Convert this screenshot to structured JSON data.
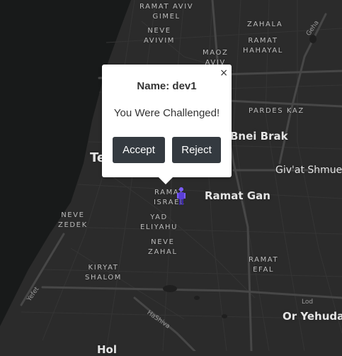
{
  "map": {
    "places": [
      {
        "key": "ramat_aviv_gimel",
        "label": "RAMAT AVIV\nGIMEL"
      },
      {
        "key": "neve_avivim",
        "label": "NEVE\nAVIVIM"
      },
      {
        "key": "zahala",
        "label": "ZAHALA"
      },
      {
        "key": "maoz_aviv",
        "label": "MAOZ\nAVIV"
      },
      {
        "key": "ramat_hahayal",
        "label": "RAMAT\nHAHAYAL"
      },
      {
        "key": "pardes_kaz",
        "label": "PARDES KAZ"
      },
      {
        "key": "ramat_israel",
        "label": "RAMAT\nISRAEL"
      },
      {
        "key": "neve_zedek",
        "label": "NEVE\nZEDEK"
      },
      {
        "key": "yad_eliyahu",
        "label": "YAD\nELIYAHU"
      },
      {
        "key": "neve_zahal",
        "label": "NEVE\nZAHAL"
      },
      {
        "key": "kiryat_shalom",
        "label": "KIRYAT\nSHALOM"
      },
      {
        "key": "ramat_efal",
        "label": "RAMAT\nEFAL"
      }
    ],
    "cities": {
      "bnei_brak": "Bnei Brak",
      "givat_shmuel": "Giv'at Shmuel",
      "ramat_gan": "Ramat Gan",
      "or_yehuda": "Or Yehuda",
      "tel_aviv_partial": "Te",
      "holon_partial": "Hol"
    },
    "roads": {
      "geha": "Geha",
      "hashiva": "HaShiva",
      "yefet": "Yefet",
      "lod": "Lod"
    },
    "colors": {
      "sea": "#181a1a",
      "land": "#2b2b2b",
      "road": "#3e3e3e",
      "major_road": "#4a4a4a"
    }
  },
  "popup": {
    "name_label": "Name: dev1",
    "message": "You Were Challenged!",
    "accept_label": "Accept",
    "reject_label": "Reject",
    "close_symbol": "×"
  },
  "player": {
    "icon": "player-avatar-icon",
    "color": "#7b5cff"
  }
}
